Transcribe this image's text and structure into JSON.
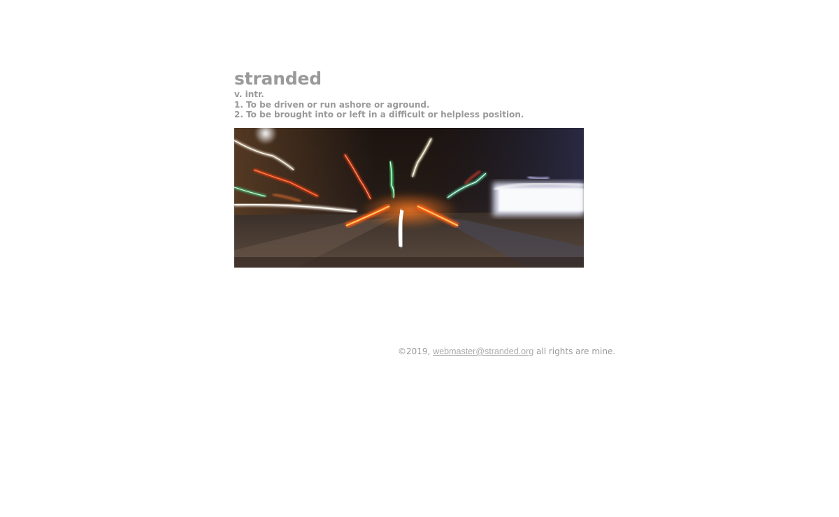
{
  "definition": {
    "word": "stranded",
    "part_of_speech": "v. intr.",
    "sense_1": "1. To be driven or run ashore or aground.",
    "sense_2": "2. To be brought into or left in a difficult or helpless position."
  },
  "photo": {
    "subject": "long-exposure night street with streaking car lights"
  },
  "footer": {
    "copyright": "©2019,",
    "email": "webmaster@stranded.org",
    "rights": "all rights are mine."
  },
  "colors": {
    "text_gray": "#999999",
    "background": "#ffffff"
  }
}
